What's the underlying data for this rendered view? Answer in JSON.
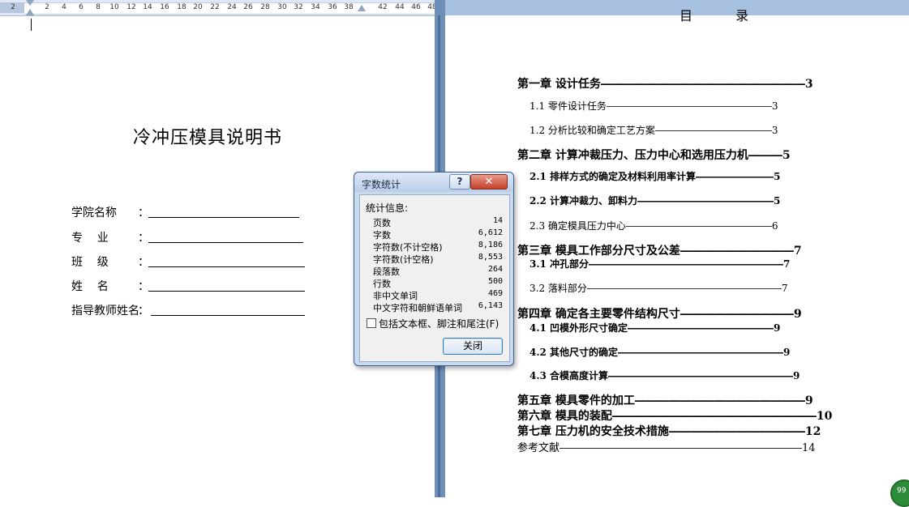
{
  "ruler": {
    "labels": [
      "2",
      "2",
      "4",
      "6",
      "8",
      "10",
      "12",
      "14",
      "16",
      "18",
      "20",
      "22",
      "24",
      "26",
      "28",
      "30",
      "32",
      "34",
      "36",
      "38",
      "42",
      "44",
      "46",
      "48"
    ]
  },
  "left_page": {
    "title": "冷冲压模具说明书",
    "fields": [
      {
        "label": "学院名称",
        "colon": "："
      },
      {
        "label": "专    业",
        "colon": "："
      },
      {
        "label": "班    级",
        "colon": "："
      },
      {
        "label": "姓    名",
        "colon": "："
      },
      {
        "label": "指导教师姓名",
        "colon": "："
      }
    ]
  },
  "right_page": {
    "heading": "目 录",
    "toc": [
      {
        "text": "第一章 设计任务――――――――――――――――――3",
        "style": "ch"
      },
      {
        "text": "1.1 零件设计任务―――――――――――――――――3",
        "style": "sub"
      },
      {
        "text": "1.2 分析比较和确定工艺方案――――――――――――3",
        "style": "sub"
      },
      {
        "text": "第二章 计算冲裁压力、压力中心和选用压力机―――5",
        "style": "ch"
      },
      {
        "text": "2.1 排样方式的确定及材料利用率计算――――――――5",
        "style": "subb"
      },
      {
        "text": "2.2 计算冲裁力、卸料力――――――――――――――5",
        "style": "subb"
      },
      {
        "text": "2.3 确定模具压力中心―――――――――――――――6",
        "style": "sub"
      },
      {
        "text": "第三章 模具工作部分尺寸及公差――――――――――7",
        "style": "ch"
      },
      {
        "text": "3.1 冲孔部分――――――――――――――――――――7",
        "style": "subb"
      },
      {
        "text": "3.2 落料部分――――――――――――――――――――7",
        "style": "sub"
      },
      {
        "text": "第四章 确定各主要零件结构尺寸――――――――――9",
        "style": "ch"
      },
      {
        "text": "4.1 凹模外形尺寸确定―――――――――――――――9",
        "style": "subb"
      },
      {
        "text": "4.2 其他尺寸的确定―――――――――――――――――9",
        "style": "subb"
      },
      {
        "text": "4.3 合模高度计算―――――――――――――――――――9",
        "style": "subb"
      },
      {
        "text": "第五章 模具零件的加工―――――――――――――――9",
        "style": "ch"
      },
      {
        "text": "第六章 模具的装配――――――――――――――――――10",
        "style": "ch"
      },
      {
        "text": "第七章 压力机的安全技术措施――――――――――――12",
        "style": "ch"
      },
      {
        "text": "参考文献―――――――――――――――――――――――14",
        "style": "ref"
      }
    ]
  },
  "dialog": {
    "title": "字数统计",
    "help": "?",
    "close": "✕",
    "group_label": "统计信息:",
    "stats": [
      {
        "key": "页数",
        "value": "14"
      },
      {
        "key": "字数",
        "value": "6,612"
      },
      {
        "key": "字符数(不计空格)",
        "value": "8,186"
      },
      {
        "key": "字符数(计空格)",
        "value": "8,553"
      },
      {
        "key": "段落数",
        "value": "264"
      },
      {
        "key": "行数",
        "value": "500"
      },
      {
        "key": "非中文单词",
        "value": "469"
      },
      {
        "key": "中文字符和朝鲜语单词",
        "value": "6,143"
      }
    ],
    "checkbox_label": "包括文本框、脚注和尾注(F)",
    "close_button": "关闭"
  },
  "badge": {
    "text": "99"
  },
  "colors": {
    "ruler_bg": "#dfe8f5",
    "gutter": "#6f8fb9",
    "dialog_frame": "#c9d9ee",
    "close_red": "#c3412a"
  }
}
